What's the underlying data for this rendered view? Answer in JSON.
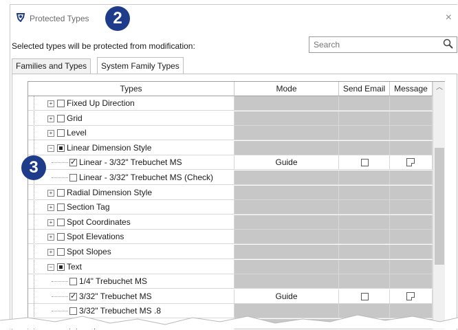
{
  "dialog": {
    "title": "Protected Types",
    "close_glyph": "×",
    "instruction": "Selected types will be protected from modification:",
    "search": {
      "placeholder": "Search",
      "value": "",
      "icon": "search-icon"
    }
  },
  "annotations": [
    "2",
    "3"
  ],
  "tabs": [
    {
      "label": "Families and Types",
      "active": false
    },
    {
      "label": "System Family Types",
      "active": true
    }
  ],
  "table": {
    "columns": [
      "Types",
      "Mode",
      "Send Email",
      "Message"
    ],
    "rows": [
      {
        "label": "Fixed Up Direction",
        "expander": "+",
        "checkbox": "unchecked"
      },
      {
        "label": "Grid",
        "expander": "+",
        "checkbox": "unchecked"
      },
      {
        "label": "Level",
        "expander": "+",
        "checkbox": "unchecked"
      },
      {
        "label": "Linear Dimension Style",
        "expander": "−",
        "checkbox": "partial"
      },
      {
        "label": "Linear - 3/32\" Trebuchet MS",
        "checkbox": "checked",
        "mode": "Guide",
        "send_email": false,
        "message": true
      },
      {
        "label": "Linear - 3/32\" Trebuchet MS (Check)",
        "checkbox": "unchecked"
      },
      {
        "label": "Radial Dimension Style",
        "expander": "+",
        "checkbox": "unchecked"
      },
      {
        "label": "Section Tag",
        "expander": "+",
        "checkbox": "unchecked"
      },
      {
        "label": "Spot Coordinates",
        "expander": "+",
        "checkbox": "unchecked"
      },
      {
        "label": "Spot Elevations",
        "expander": "+",
        "checkbox": "unchecked"
      },
      {
        "label": "Spot Slopes",
        "expander": "+",
        "checkbox": "unchecked"
      },
      {
        "label": "Text",
        "expander": "−",
        "checkbox": "partial"
      },
      {
        "label": "1/4\" Trebuchet MS",
        "checkbox": "unchecked"
      },
      {
        "label": "3/32\" Trebuchet MS",
        "checkbox": "checked",
        "mode": "Guide",
        "send_email": false,
        "message": true
      },
      {
        "label": "3/32\" Trebuchet MS .8",
        "checkbox": "unchecked"
      },
      {
        "label": "Large Counts",
        "checkbox": "unchecked"
      }
    ]
  },
  "colors": {
    "badge": "#1f3c8a",
    "disabled_cell": "#c7c7c7"
  }
}
